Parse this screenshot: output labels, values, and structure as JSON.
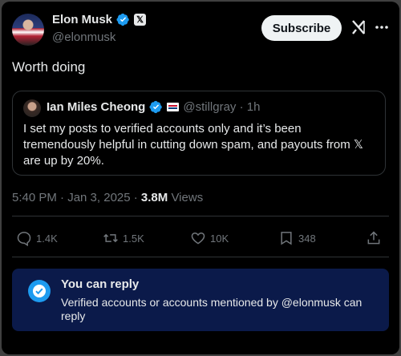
{
  "author": {
    "name": "Elon Musk",
    "handle": "@elonmusk"
  },
  "header": {
    "subscribe_label": "Subscribe"
  },
  "tweet": {
    "text": "Worth doing"
  },
  "quote": {
    "author_name": "Ian Miles Cheong",
    "meta": "@stillgray · 1h",
    "text": "I set my posts to verified accounts only and it’s been tremendously helpful in cutting down spam, and payouts from 𝕏 are up by 20%."
  },
  "meta": {
    "timestamp": "5:40 PM · Jan 3, 2025 · ",
    "views_count": "3.8M",
    "views_label": " Views"
  },
  "actions": {
    "replies": "1.4K",
    "reposts": "1.5K",
    "likes": "10K",
    "bookmarks": "348"
  },
  "reply_restriction": {
    "title": "You can reply",
    "description": "Verified accounts or accounts mentioned by @elonmusk can reply"
  },
  "icons": {
    "verified": "verified-badge-icon",
    "x_badge": "x-affiliate-icon",
    "grok": "grok-icon",
    "more": "more-icon",
    "reply": "reply-icon",
    "repost": "repost-icon",
    "like": "heart-icon",
    "bookmark": "bookmark-icon",
    "share": "share-icon"
  },
  "colors": {
    "accent": "#1d9bf0",
    "background": "#000000",
    "muted": "#71767b",
    "reply_box": "#0b1a4a"
  }
}
